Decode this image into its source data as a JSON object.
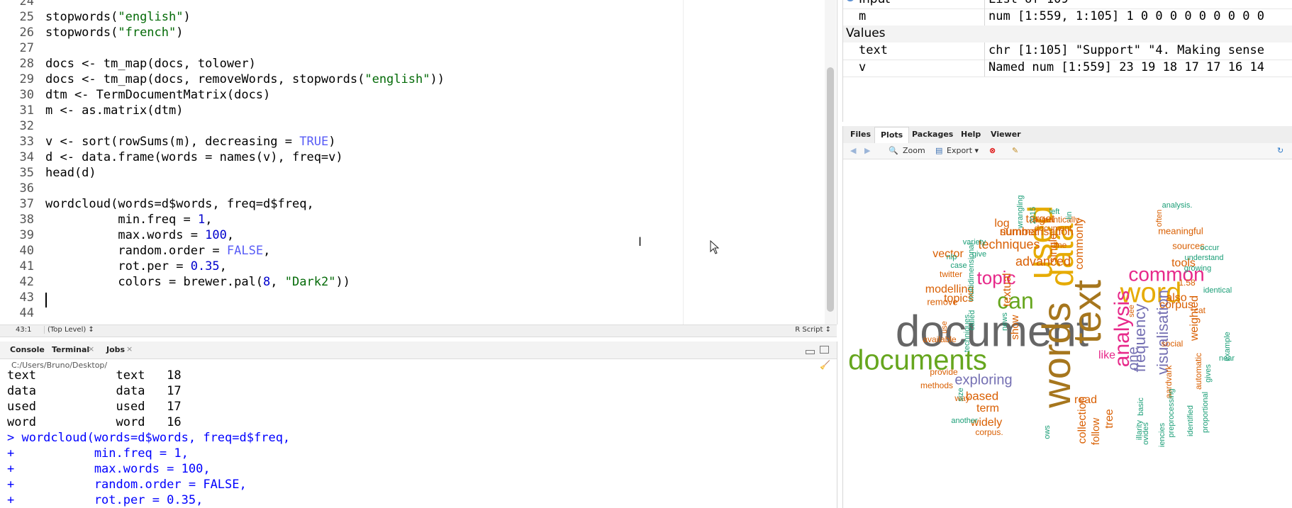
{
  "editor": {
    "line_numbers": [
      "24",
      "25",
      "26",
      "27",
      "28",
      "29",
      "30",
      "31",
      "32",
      "33",
      "34",
      "35",
      "36",
      "37",
      "38",
      "39",
      "40",
      "41",
      "42",
      "43",
      "44"
    ],
    "lines": [
      [],
      [
        [
          "stopwords(",
          ""
        ],
        [
          "\"english\"",
          "str"
        ],
        [
          ")",
          ""
        ]
      ],
      [
        [
          "stopwords(",
          ""
        ],
        [
          "\"french\"",
          "str"
        ],
        [
          ")",
          ""
        ]
      ],
      [],
      [
        [
          "docs <- tm_map(docs, tolower)",
          ""
        ]
      ],
      [
        [
          "docs <- tm_map(docs, removeWords, stopwords(",
          ""
        ],
        [
          "\"english\"",
          "str"
        ],
        [
          "))",
          ""
        ]
      ],
      [
        [
          "dtm <- TermDocumentMatrix(docs)",
          ""
        ]
      ],
      [
        [
          "m <- as.matrix(dtm)",
          ""
        ]
      ],
      [],
      [
        [
          "v <- sort(rowSums(m), decreasing = ",
          ""
        ],
        [
          "TRUE",
          "kw"
        ],
        [
          ")",
          ""
        ]
      ],
      [
        [
          "d <- data.frame(words = names(v), freq=v)",
          ""
        ]
      ],
      [
        [
          "head(d)",
          ""
        ]
      ],
      [],
      [
        [
          "wordcloud(words=d$words, freq=d$freq,",
          ""
        ]
      ],
      [
        [
          "          min.freq = ",
          ""
        ],
        [
          "1",
          "num"
        ],
        [
          ",",
          ""
        ]
      ],
      [
        [
          "          max.words = ",
          ""
        ],
        [
          "100",
          "num"
        ],
        [
          ",",
          ""
        ]
      ],
      [
        [
          "          random.order = ",
          ""
        ],
        [
          "FALSE",
          "kw"
        ],
        [
          ",",
          ""
        ]
      ],
      [
        [
          "          rot.per = ",
          ""
        ],
        [
          "0.35",
          "num"
        ],
        [
          ",",
          ""
        ]
      ],
      [
        [
          "          colors = brewer.pal(",
          ""
        ],
        [
          "8",
          "num"
        ],
        [
          ", ",
          ""
        ],
        [
          "\"Dark2\"",
          "str"
        ],
        [
          "))",
          ""
        ]
      ],
      [],
      []
    ],
    "status": {
      "position": "43:1",
      "scope": "(Top Level) ↕",
      "filetype": "R Script ↕"
    }
  },
  "console": {
    "tabs": [
      "Console",
      "Terminal",
      "Jobs"
    ],
    "path": "C:/Users/Bruno/Desktop/",
    "lines": [
      [
        "text           text   18",
        "out"
      ],
      [
        "data           data   17",
        "out"
      ],
      [
        "used           used   17",
        "out"
      ],
      [
        "word           word   16",
        "out"
      ],
      [
        "> wordcloud(words=d$words, freq=d$freq,",
        "in"
      ],
      [
        "+           min.freq = 1,",
        "in"
      ],
      [
        "+           max.words = 100,",
        "in"
      ],
      [
        "+           random.order = FALSE,",
        "in"
      ],
      [
        "+           rot.per = 0.35,",
        "in"
      ]
    ]
  },
  "environment": {
    "top_row": {
      "name": "Input",
      "value": "List of 109"
    },
    "rows": [
      {
        "name": "m",
        "value": "num [1:559, 1:105] 1 0 0 0 0 0 0 0 0 0"
      }
    ],
    "section": "Values",
    "values": [
      {
        "name": "text",
        "value": "chr [1:105] \"Support\" \"4. Making sense"
      },
      {
        "name": "v",
        "value": "Named num [1:559] 23 19 18 17 17 16 14"
      }
    ]
  },
  "plots_pane": {
    "tabs": [
      "Files",
      "Plots",
      "Packages",
      "Help",
      "Viewer"
    ],
    "active_tab": "Plots",
    "toolbar": {
      "zoom": "Zoom",
      "export": "Export ▾"
    },
    "colors": {
      "teal": "#1b9e77",
      "orange": "#d95f02",
      "purple": "#7570b3",
      "pink": "#e7298a",
      "green": "#66a61e",
      "gold": "#e6ab02",
      "brown": "#a6761d",
      "grey": "#666666"
    },
    "words": [
      {
        "t": "document",
        "c": "grey",
        "s": 62,
        "r": 0
      },
      {
        "t": "documents",
        "c": "green",
        "s": 40,
        "r": 0
      },
      {
        "t": "words",
        "c": "brown",
        "s": 56,
        "r": -90
      },
      {
        "t": "text",
        "c": "brown",
        "s": 56,
        "r": -90
      },
      {
        "t": "data",
        "c": "gold",
        "s": 46,
        "r": -90
      },
      {
        "t": "used",
        "c": "gold",
        "s": 48,
        "r": -90
      },
      {
        "t": "word",
        "c": "gold",
        "s": 40,
        "r": 0
      },
      {
        "t": "common",
        "c": "pink",
        "s": 28,
        "r": 0
      },
      {
        "t": "can",
        "c": "green",
        "s": 32,
        "r": 0
      },
      {
        "t": "topic",
        "c": "pink",
        "s": 26,
        "r": 0
      },
      {
        "t": "analysis",
        "c": "pink",
        "s": 30,
        "r": -90
      },
      {
        "t": "visualisation",
        "c": "purple",
        "s": 22,
        "r": -90
      },
      {
        "t": "frequency",
        "c": "purple",
        "s": 22,
        "r": -90
      },
      {
        "t": "exploring",
        "c": "purple",
        "s": 20,
        "r": 0
      },
      {
        "t": "advanced",
        "c": "orange",
        "s": 18,
        "r": 0
      },
      {
        "t": "techniques",
        "c": "orange",
        "s": 18,
        "r": 0
      },
      {
        "t": "summarisation",
        "c": "orange",
        "s": 16,
        "r": 0
      },
      {
        "t": "number",
        "c": "orange",
        "s": 16,
        "r": 0
      },
      {
        "t": "target",
        "c": "orange",
        "s": 16,
        "r": 0
      },
      {
        "t": "log",
        "c": "orange",
        "s": 16,
        "r": 0
      },
      {
        "t": "vector",
        "c": "orange",
        "s": 16,
        "r": 0
      },
      {
        "t": "topics",
        "c": "orange",
        "s": 16,
        "r": 0
      },
      {
        "t": "modelling",
        "c": "orange",
        "s": 16,
        "r": 0
      },
      {
        "t": "also",
        "c": "orange",
        "s": 16,
        "r": 0
      },
      {
        "t": "corpus",
        "c": "orange",
        "s": 16,
        "r": 0
      },
      {
        "t": "tools",
        "c": "orange",
        "s": 16,
        "r": 0
      },
      {
        "t": "based",
        "c": "orange",
        "s": 17,
        "r": 0
      },
      {
        "t": "term",
        "c": "orange",
        "s": 16,
        "r": 0
      },
      {
        "t": "widely",
        "c": "orange",
        "s": 16,
        "r": 0
      },
      {
        "t": "read",
        "c": "orange",
        "s": 16,
        "r": 0
      },
      {
        "t": "like",
        "c": "pink",
        "s": 16,
        "r": 0
      },
      {
        "t": "one",
        "c": "purple",
        "s": 20,
        "r": -90
      },
      {
        "t": "commonly",
        "c": "orange",
        "s": 16,
        "r": -90
      },
      {
        "t": "single",
        "c": "orange",
        "s": 16,
        "r": -90
      },
      {
        "t": "textual",
        "c": "orange",
        "s": 16,
        "r": -90
      },
      {
        "t": "show",
        "c": "orange",
        "s": 15,
        "r": -90
      },
      {
        "t": "weighted",
        "c": "orange",
        "s": 16,
        "r": -90
      },
      {
        "t": "collection",
        "c": "orange",
        "s": 16,
        "r": -90
      },
      {
        "t": "tree",
        "c": "orange",
        "s": 16,
        "r": -90
      },
      {
        "t": "follow",
        "c": "orange",
        "s": 15,
        "r": -90
      },
      {
        "t": "meaningful",
        "c": "orange",
        "s": 13,
        "r": 0
      },
      {
        "t": "sources",
        "c": "orange",
        "s": 13,
        "r": 0
      },
      {
        "t": "document",
        "c": "orange",
        "s": 12,
        "r": 0
      },
      {
        "t": "semantically",
        "c": "orange",
        "s": 12,
        "r": 0
      },
      {
        "t": "-line",
        "c": "orange",
        "s": 12,
        "r": 0
      },
      {
        "t": "1.58",
        "c": "orange",
        "s": 12,
        "r": 0
      },
      {
        "t": "remove",
        "c": "orange",
        "s": 13,
        "r": 0
      },
      {
        "t": "available",
        "c": "orange",
        "s": 12,
        "r": 0
      },
      {
        "t": "provide",
        "c": "orange",
        "s": 12,
        "r": 0
      },
      {
        "t": "methods",
        "c": "orange",
        "s": 12,
        "r": 0
      },
      {
        "t": "way",
        "c": "orange",
        "s": 12,
        "r": 0
      },
      {
        "t": "corpus.",
        "c": "orange",
        "s": 12,
        "r": 0
      },
      {
        "t": "social",
        "c": "orange",
        "s": 12,
        "r": 0
      },
      {
        "t": "cat",
        "c": "orange",
        "s": 12,
        "r": 0
      },
      {
        "t": "twitter",
        "c": "orange",
        "s": 12,
        "r": 0
      },
      {
        "t": "aardvark",
        "c": "orange",
        "s": 12,
        "r": -90
      },
      {
        "t": "automatic",
        "c": "orange",
        "s": 12,
        "r": -90
      },
      {
        "t": "often",
        "c": "orange",
        "s": 11,
        "r": -90
      },
      {
        "t": "see",
        "c": "orange",
        "s": 11,
        "r": -90
      },
      {
        "t": "use",
        "c": "orange",
        "s": 11,
        "r": -90
      },
      {
        "t": "variety",
        "c": "teal",
        "s": 11,
        "r": 0
      },
      {
        "t": "give",
        "c": "teal",
        "s": 11,
        "r": 0
      },
      {
        "t": "nlp",
        "c": "teal",
        "s": 11,
        "r": 0
      },
      {
        "t": "case",
        "c": "teal",
        "s": 11,
        "r": 0
      },
      {
        "t": "left",
        "c": "teal",
        "s": 11,
        "r": 0
      },
      {
        "t": "analysis.",
        "c": "teal",
        "s": 11,
        "r": 0
      },
      {
        "t": "occur",
        "c": "teal",
        "s": 11,
        "r": 0
      },
      {
        "t": "understand",
        "c": "teal",
        "s": 11,
        "r": 0
      },
      {
        "t": "growing",
        "c": "teal",
        "s": 11,
        "r": 0
      },
      {
        "t": "identical",
        "c": "teal",
        "s": 11,
        "r": 0
      },
      {
        "t": "near",
        "c": "teal",
        "s": 11,
        "r": 0
      },
      {
        "t": "gives",
        "c": "teal",
        "s": 11,
        "r": -90
      },
      {
        "t": "example",
        "c": "teal",
        "s": 11,
        "r": -90
      },
      {
        "t": "another",
        "c": "teal",
        "s": 11,
        "r": 0
      },
      {
        "t": "multidimensional",
        "c": "teal",
        "s": 11,
        "r": -90
      },
      {
        "t": "wrangling",
        "c": "teal",
        "s": 11,
        "r": -90
      },
      {
        "t": "2015",
        "c": "teal",
        "s": 11,
        "r": -90
      },
      {
        "t": "-lin",
        "c": "teal",
        "s": 11,
        "r": -90
      },
      {
        "t": "techniques.",
        "c": "teal",
        "s": 11,
        "r": -90
      },
      {
        "t": "called",
        "c": "teal",
        "s": 11,
        "r": -90
      },
      {
        "t": "news",
        "c": "teal",
        "s": 11,
        "r": -90
      },
      {
        "t": "size",
        "c": "teal",
        "s": 11,
        "r": -90
      },
      {
        "t": "basic",
        "c": "teal",
        "s": 11,
        "r": -90
      },
      {
        "t": "illarity",
        "c": "teal",
        "s": 11,
        "r": -90
      },
      {
        "t": "ovides",
        "c": "teal",
        "s": 11,
        "r": -90
      },
      {
        "t": "iencies",
        "c": "teal",
        "s": 11,
        "r": -90
      },
      {
        "t": "preprocessing",
        "c": "teal",
        "s": 11,
        "r": -90
      },
      {
        "t": "identified",
        "c": "teal",
        "s": 11,
        "r": -90
      },
      {
        "t": "proportional",
        "c": "teal",
        "s": 11,
        "r": -90
      },
      {
        "t": "ows",
        "c": "teal",
        "s": 11,
        "r": -90
      }
    ]
  }
}
